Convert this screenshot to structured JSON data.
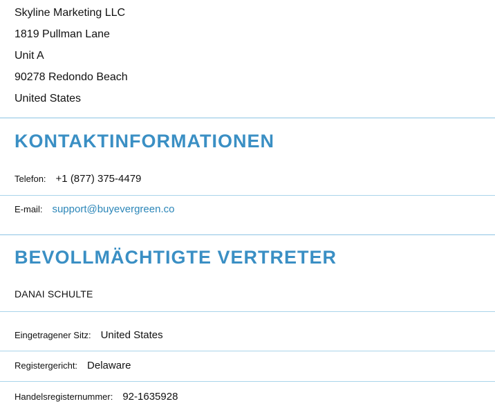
{
  "address": {
    "company": "Skyline Marketing LLC",
    "street": "1819 Pullman Lane",
    "unit": "Unit A",
    "city_line": "90278 Redondo Beach",
    "country": "United States"
  },
  "contact": {
    "heading": "KONTAKTINFORMATIONEN",
    "phone_label": "Telefon:",
    "phone_value": "+1 (877) 375-4479",
    "email_label": "E-mail:",
    "email_value": "support@buyevergreen.co"
  },
  "representatives": {
    "heading": "BEVOLLMÄCHTIGTE VERTRETER",
    "name": "DANAI SCHULTE"
  },
  "registry": {
    "seat_label": "Eingetragener Sitz:",
    "seat_value": "United States",
    "court_label": "Registergericht:",
    "court_value": "Delaware",
    "number_label": "Handelsregisternummer:",
    "number_value": "92-1635928"
  },
  "colors": {
    "heading": "#3a8fc4",
    "link": "#2b86b8",
    "divider": "#a9d4ea"
  }
}
